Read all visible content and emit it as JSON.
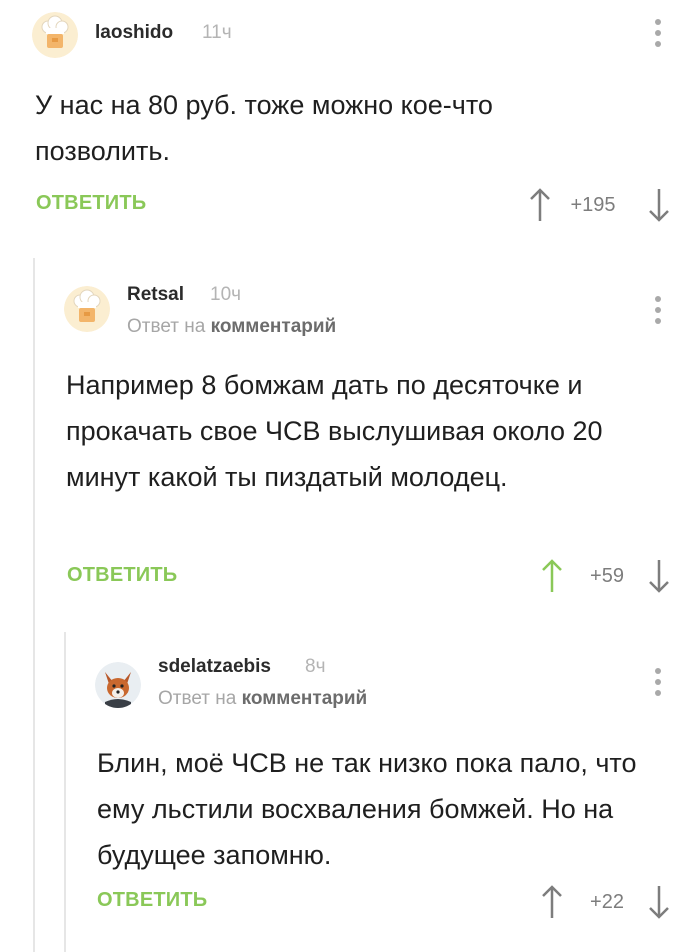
{
  "comments": [
    {
      "username": "laoshido",
      "time": "11ч",
      "text": "У нас на 80 руб. тоже можно кое-что позволить.",
      "reply_label": "ОТВЕТИТЬ",
      "score": "+195",
      "avatar_icon": "chef-hat-avatar",
      "upvote_active": false
    },
    {
      "username": "Retsal",
      "time": "10ч",
      "reply_prefix": "Ответ на",
      "reply_target": "комментарий",
      "text": "Например 8 бомжам дать по десяточке и прокачать свое ЧСВ выслушивая около 20 минут какой ты пиздатый молодец.",
      "reply_label": "ОТВЕТИТЬ",
      "score": "+59",
      "avatar_icon": "chef-hat-avatar",
      "upvote_active": true
    },
    {
      "username": "sdelatzaebis",
      "time": "8ч",
      "reply_prefix": "Ответ на",
      "reply_target": "комментарий",
      "text": "Блин, моё ЧСВ не так низко пока пало, что ему льстили восхваления бомжей. Но на будущее запомню.",
      "reply_label": "ОТВЕТИТЬ",
      "score": "+22",
      "avatar_icon": "fox-avatar",
      "upvote_active": false
    }
  ],
  "colors": {
    "accent_green": "#8ac858",
    "text": "#1f1f1f",
    "muted": "#a6a6a6",
    "thread_line": "#e6e6e6"
  }
}
